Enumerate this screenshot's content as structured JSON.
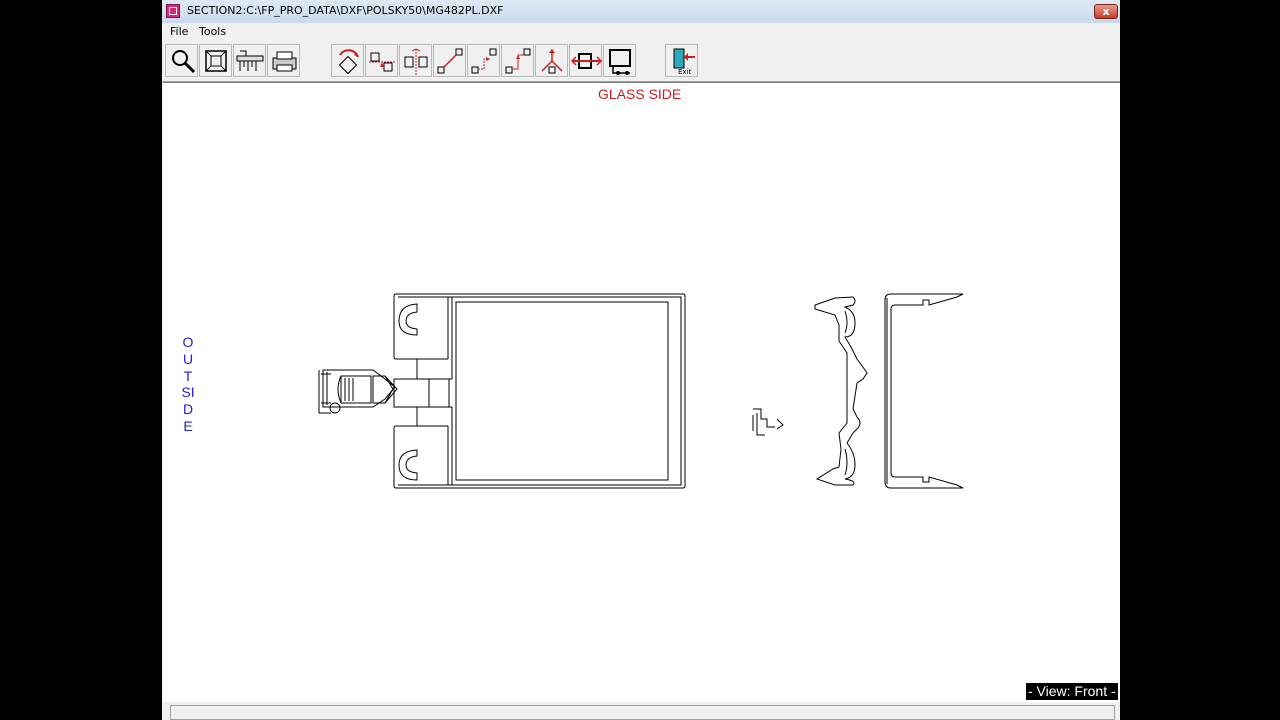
{
  "window": {
    "title": "SECTION2:C:\\FP_PRO_DATA\\DXF\\POLSKY50\\MG482PL.DXF",
    "close_label": "x"
  },
  "menu": {
    "items": [
      "File",
      "Tools"
    ]
  },
  "toolbar": {
    "tools": [
      "zoom-icon",
      "zoom-extents-icon",
      "measure-icon",
      "print-icon",
      "rotate-icon",
      "align-icon",
      "center-icon",
      "dimension-icon",
      "step-icon",
      "offset-icon",
      "axis-icon",
      "properties-icon",
      "scale-icon",
      "exit-icon"
    ],
    "exit_label": "Exit",
    "colors": {
      "accent": "#cc2020",
      "exit_door": "#2aa9b8"
    }
  },
  "canvas": {
    "glass_side_label": "GLASS SIDE",
    "outside_label": "OUTSIDE",
    "view_label": "- View: Front -",
    "colors": {
      "glass_side": "#cc2020",
      "outside": "#2020cc",
      "drawing": "#000000"
    }
  }
}
